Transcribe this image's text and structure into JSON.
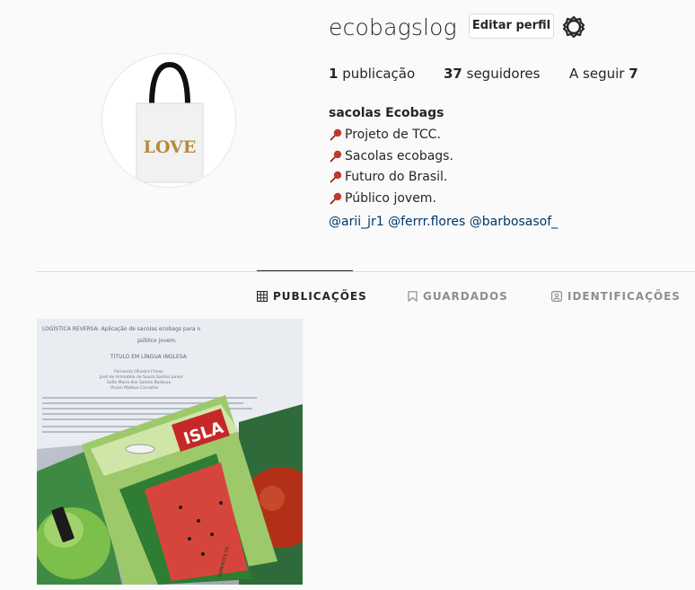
{
  "profile": {
    "username": "ecobagslog",
    "edit_label": "Editar perfil",
    "avatar_text": "LOVE"
  },
  "stats": {
    "posts_count": "1",
    "posts_label": " publicação",
    "followers_count": "37",
    "followers_label": " seguidores",
    "following_label": "A seguir ",
    "following_count": "7"
  },
  "bio": {
    "name": "sacolas Ecobags",
    "lines": [
      "Projeto de TCC.",
      "Sacolas ecobags.",
      "Futuro do Brasil.",
      "Público jovem."
    ],
    "mentions": "@arii_jr1 @ferrr.flores @barbosasof_"
  },
  "tabs": [
    {
      "label": "PUBLICAÇÕES",
      "icon": "grid-icon"
    },
    {
      "label": "GUARDADOS",
      "icon": "bookmark-icon"
    },
    {
      "label": "IDENTIFICAÇÕES",
      "icon": "tag-user-icon"
    }
  ],
  "post": {
    "doc_title": "LOGÍSTICA REVERSA: Aplicação de sacolas ecobags para o",
    "doc_title2": "público jovem.",
    "doc_subtitle": "TITULO EM LÍNGUA INGLESA",
    "doc_authors": [
      "Fernanda Oliveira Flores",
      "José de Arimatéia de Souza Santos Júnior",
      "Sofia Maria dos Santos Barbosa",
      "Vivian Mateus Carvalho"
    ],
    "packet_brand": "ISLA",
    "packet_label": "SEMENTES DE"
  },
  "colors": {
    "pin": "#c0392b",
    "mention": "#00376b",
    "accent": "#262626"
  }
}
